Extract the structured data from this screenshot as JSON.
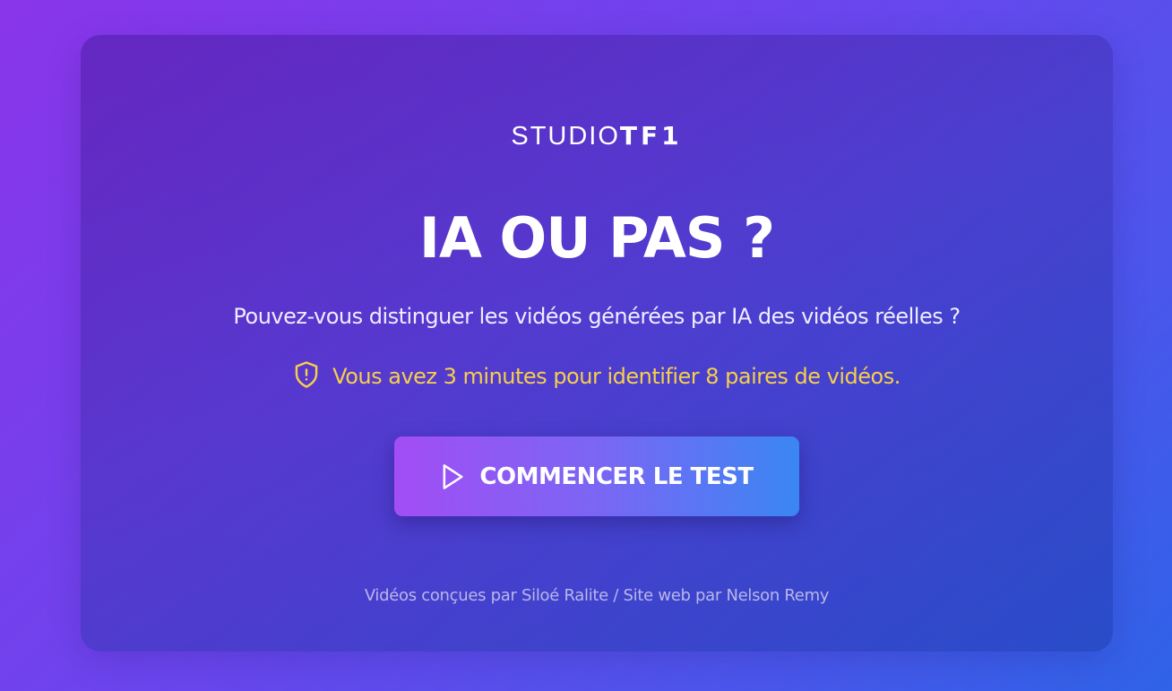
{
  "logo": {
    "part1": "STUDIO",
    "part2": "TF1"
  },
  "title": "IA OU PAS ?",
  "subtitle": "Pouvez-vous distinguer les vidéos générées par IA des vidéos réelles ?",
  "notice": {
    "icon": "shield-alert-icon",
    "text": "Vous avez 3 minutes pour identifier 8 paires de vidéos."
  },
  "start_button": {
    "icon": "play-icon",
    "label": "COMMENCER LE TEST"
  },
  "credits": "Vidéos conçues par Siloé Ralite / Site web par Nelson Remy",
  "colors": {
    "notice": "#f7cf4a",
    "button_start": "#a24df5",
    "button_end": "#3a86f3"
  }
}
